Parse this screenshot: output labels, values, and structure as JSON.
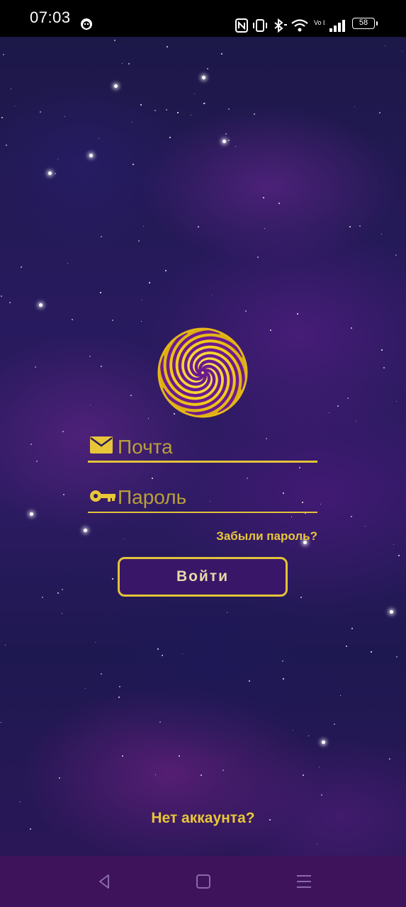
{
  "status_bar": {
    "time": "07:03",
    "battery": "58",
    "network_label": "Vo LTE",
    "icons": [
      "app-notification-icon",
      "nfc-icon",
      "vibrate-icon",
      "bluetooth-icon",
      "wifi-icon",
      "volte-icon",
      "signal-icon",
      "battery-icon"
    ]
  },
  "logo": {
    "name": "spiral-logo",
    "colors": [
      "#f5d21c",
      "#7a1fa0"
    ]
  },
  "form": {
    "email": {
      "icon": "mail-icon",
      "placeholder": "Почта",
      "value": ""
    },
    "password": {
      "icon": "key-icon",
      "placeholder": "Пароль",
      "value": ""
    },
    "forgot_label": "Забыли пароль?",
    "login_label": "Войти"
  },
  "signup_label": "Нет аккаунта?",
  "nav_bar": {
    "buttons": [
      "back-icon",
      "home-icon",
      "menu-icon"
    ]
  },
  "colors": {
    "accent": "#e3c33a",
    "button_bg": "#3a1668",
    "nav_bg": "#3e135c",
    "status_bg": "#000000"
  }
}
